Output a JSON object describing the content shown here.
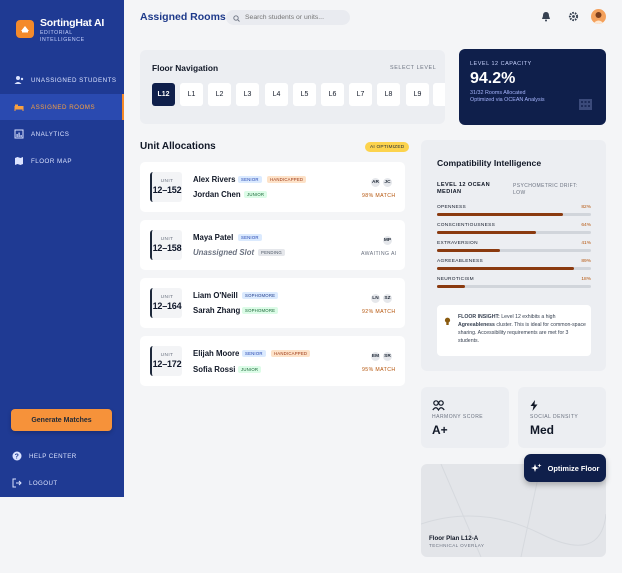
{
  "brand": {
    "name": "SortingHat AI",
    "subtitle": "EDITORIAL INTELLIGENCE"
  },
  "sidebar": {
    "items": [
      {
        "label": "UNASSIGNED STUDENTS",
        "icon": "users-icon",
        "active": false
      },
      {
        "label": "ASSIGNED ROOMS",
        "icon": "bed-icon",
        "active": true
      },
      {
        "label": "ANALYTICS",
        "icon": "chart-icon",
        "active": false
      },
      {
        "label": "FLOOR MAP",
        "icon": "map-icon",
        "active": false
      }
    ],
    "generate_button": "Generate Matches",
    "footer": [
      {
        "label": "HELP CENTER",
        "icon": "help-icon"
      },
      {
        "label": "LOGOUT",
        "icon": "logout-icon"
      }
    ]
  },
  "header": {
    "title": "Assigned Rooms",
    "search_placeholder": "Search students or units..."
  },
  "floor_navigation": {
    "title": "Floor Navigation",
    "select_label": "SELECT LEVEL",
    "floors": [
      "L12",
      "L1",
      "L2",
      "L3",
      "L4",
      "L5",
      "L6",
      "L7",
      "L8",
      "L9"
    ],
    "active": "L12"
  },
  "capacity": {
    "label": "LEVEL 12 CAPACITY",
    "value": "94.2%",
    "description": "31/32 Rooms Allocated Optimized via OCEAN Analysis"
  },
  "units": {
    "title": "Unit Allocations",
    "badge": "AI OPTIMIZED",
    "unit_label": "UNIT",
    "list": [
      {
        "number": "12–152",
        "residents": [
          {
            "name": "Alex Rivers",
            "tags": [
              {
                "text": "SENIOR",
                "type": "senior"
              },
              {
                "text": "HANDICAPPED",
                "type": "hand"
              }
            ]
          },
          {
            "name": "Jordan Chen",
            "tags": [
              {
                "text": "JUNIOR",
                "type": "junior"
              }
            ]
          }
        ],
        "initials": [
          "AR",
          "JC"
        ],
        "match": "98% MATCH"
      },
      {
        "number": "12–158",
        "residents": [
          {
            "name": "Maya Patel",
            "tags": [
              {
                "text": "SENIOR",
                "type": "senior"
              }
            ]
          },
          {
            "name": "Unassigned Slot",
            "tags": [
              {
                "text": "PENDING",
                "type": "pend"
              }
            ],
            "italic": true
          }
        ],
        "initials": [
          "MP"
        ],
        "match": "AWAITING AI"
      },
      {
        "number": "12–164",
        "residents": [
          {
            "name": "Liam O'Neill",
            "tags": [
              {
                "text": "SOPHOMORE",
                "type": "soph"
              }
            ]
          },
          {
            "name": "Sarah Zhang",
            "tags": [
              {
                "text": "SOPHOMORE",
                "type": "junior"
              }
            ]
          }
        ],
        "initials": [
          "LN",
          "SZ"
        ],
        "match": "92% MATCH"
      },
      {
        "number": "12–172",
        "residents": [
          {
            "name": "Elijah Moore",
            "tags": [
              {
                "text": "SENIOR",
                "type": "senior"
              },
              {
                "text": "HANDICAPPED",
                "type": "hand"
              }
            ]
          },
          {
            "name": "Sofia Rossi",
            "tags": [
              {
                "text": "JUNIOR",
                "type": "junior"
              }
            ]
          }
        ],
        "initials": [
          "EM",
          "SR"
        ],
        "match": "95% MATCH"
      }
    ]
  },
  "compatibility": {
    "title": "Compatibility Intelligence",
    "median_label": "LEVEL 12 OCEAN MEDIAN",
    "drift_label": "PSYCHOMETRIC DRIFT: LOW",
    "traits": [
      {
        "name": "OPENNESS",
        "value": "82%",
        "fraction": 0.82
      },
      {
        "name": "CONSCIENTIOUSNESS",
        "value": "64%",
        "fraction": 0.64
      },
      {
        "name": "EXTRAVERSION",
        "value": "41%",
        "fraction": 0.41
      },
      {
        "name": "AGREEABLENESS",
        "value": "89%",
        "fraction": 0.89
      },
      {
        "name": "NEUROTICISM",
        "value": "18%",
        "fraction": 0.18
      }
    ],
    "insight_title": "FLOOR INSIGHT:",
    "insight_text": " Level 12 exhibits a high ",
    "insight_bold": "Agreeableness",
    "insight_rest": " cluster. This is ideal for common-space sharing. Accessibility requirements are met for 3 students."
  },
  "stats": {
    "harmony": {
      "label": "HARMONY SCORE",
      "value": "A+"
    },
    "density": {
      "label": "SOCIAL DENSITY",
      "value": "Med"
    }
  },
  "map": {
    "title": "Floor Plan L12-A",
    "subtitle": "TECHNICAL OVERLAY"
  },
  "optimize_button": "Optimize Floor"
}
